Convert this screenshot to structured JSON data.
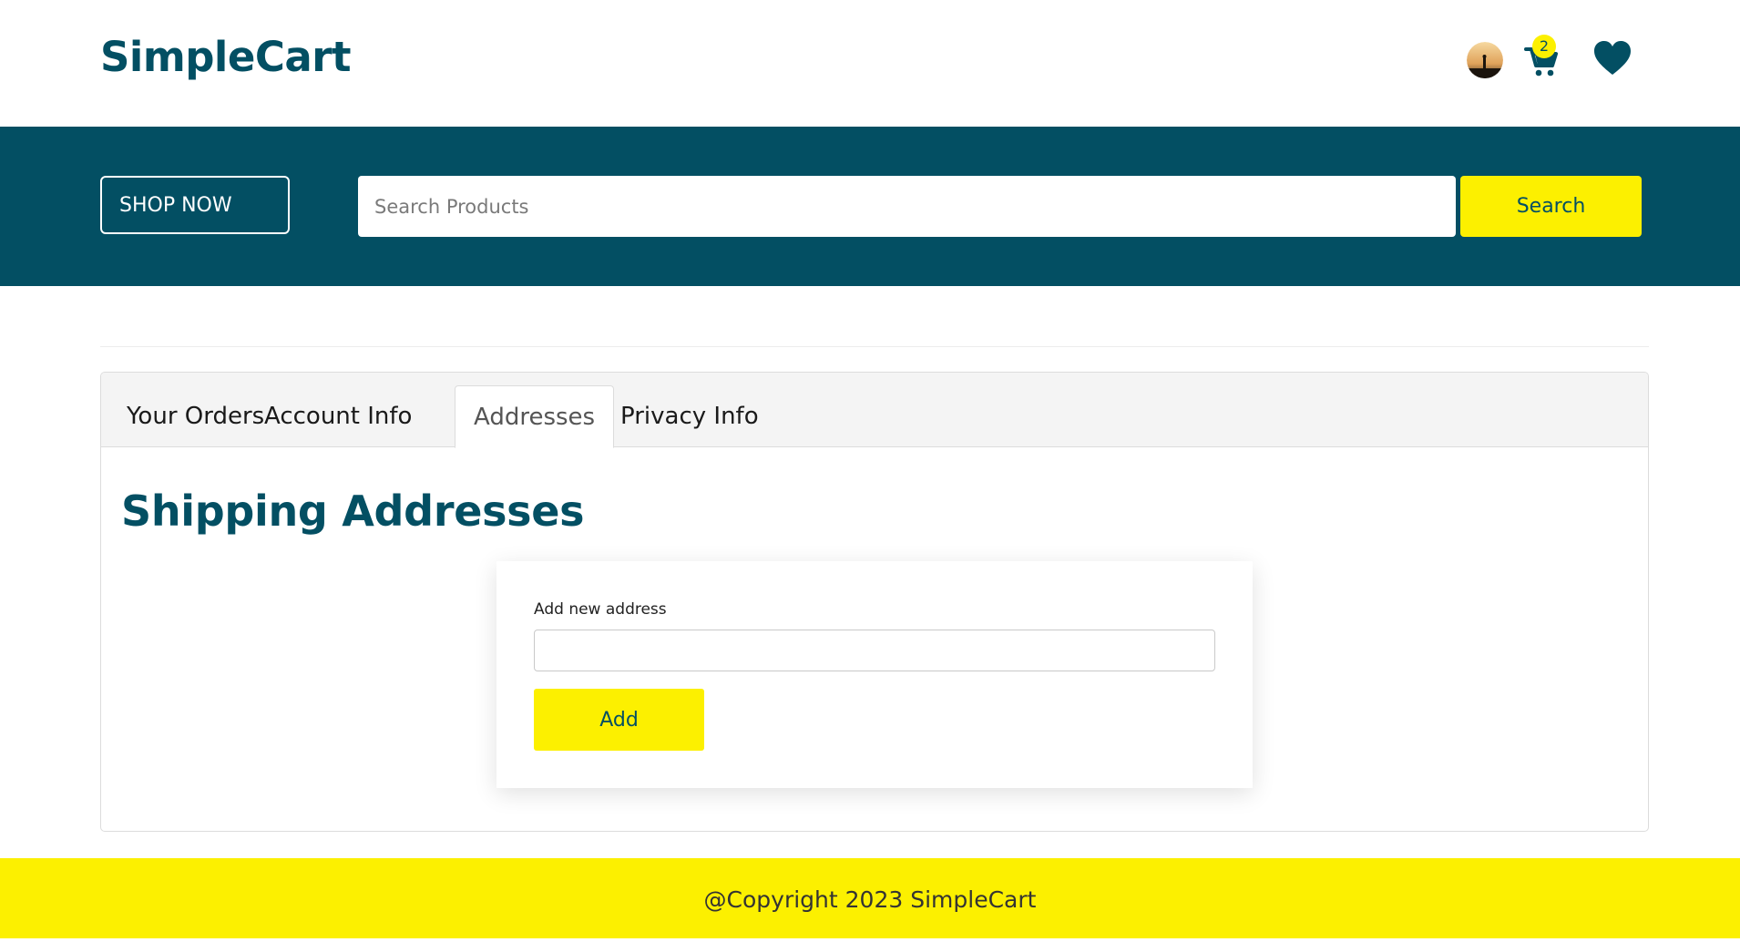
{
  "header": {
    "logo": "SimpleCart",
    "cart_count": "2",
    "icons": {
      "avatar": "user-avatar",
      "cart": "cart-icon",
      "wishlist": "heart-icon"
    }
  },
  "banner": {
    "shop_now_label": "SHOP NOW",
    "search_placeholder": "Search Products",
    "search_button": "Search"
  },
  "account": {
    "tabs": [
      {
        "label": "Your Orders",
        "active": false
      },
      {
        "label": "Account Info",
        "active": false
      },
      {
        "label": "Addresses",
        "active": true
      },
      {
        "label": "Privacy Info",
        "active": false
      }
    ],
    "section_title": "Shipping Addresses",
    "add_address": {
      "label": "Add new address",
      "value": "",
      "button": "Add"
    }
  },
  "footer": {
    "copyright": "@Copyright 2023 SimpleCart"
  },
  "colors": {
    "primary": "#034f63",
    "accent": "#fcf000",
    "tab_bg": "#f4f4f4"
  }
}
